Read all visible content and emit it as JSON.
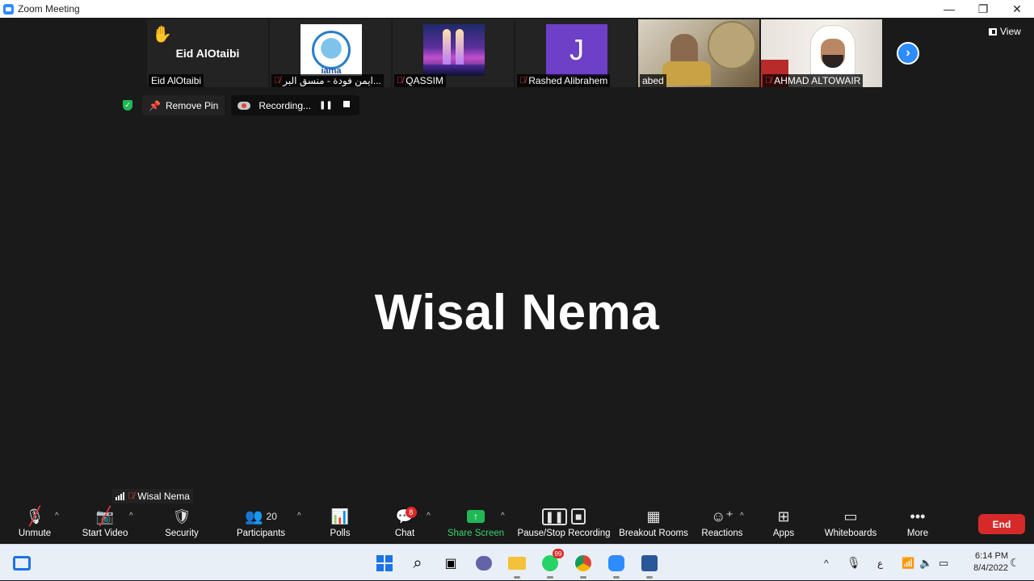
{
  "window": {
    "title": "Zoom Meeting",
    "controls": [
      "—",
      "❐",
      "✕"
    ]
  },
  "strip": {
    "tiles": [
      {
        "big_name": "Eid AlOtaibi",
        "label": "Eid AlOtaibi",
        "muted": false,
        "hand_raised": true
      },
      {
        "label": "ايمن فودة - منسق البر...",
        "muted": true,
        "logo_text": "iama"
      },
      {
        "label": "QASSIM",
        "muted": true
      },
      {
        "label": "Rashed Alibrahem",
        "muted": true,
        "avatar_letter": "J"
      },
      {
        "label": "abed",
        "muted": false
      },
      {
        "label": "AHMAD ALTOWAIR",
        "muted": true
      }
    ],
    "view_label": "View"
  },
  "pin_bar": {
    "remove_pin_label": "Remove Pin",
    "recording_label": "Recording..."
  },
  "speaker": {
    "name": "Wisal Nema"
  },
  "self_view": {
    "name": "Wisal Nema"
  },
  "toolbar": {
    "unmute": "Unmute",
    "start_video": "Start Video",
    "security": "Security",
    "participants": "Participants",
    "participants_count": "20",
    "polls": "Polls",
    "chat": "Chat",
    "chat_badge": "8",
    "share_screen": "Share Screen",
    "pause_stop_recording": "Pause/Stop Recording",
    "breakout_rooms": "Breakout Rooms",
    "reactions": "Reactions",
    "apps": "Apps",
    "whiteboards": "Whiteboards",
    "more": "More",
    "end": "End"
  },
  "taskbar": {
    "whatsapp_badge": "99",
    "language": "ع",
    "time": "6:14 PM",
    "date": "8/4/2022"
  },
  "colors": {
    "accent": "#2d8cff",
    "share_green": "#1fb855",
    "end_red": "#d62a2a",
    "stage_bg": "#1a1a1a"
  }
}
